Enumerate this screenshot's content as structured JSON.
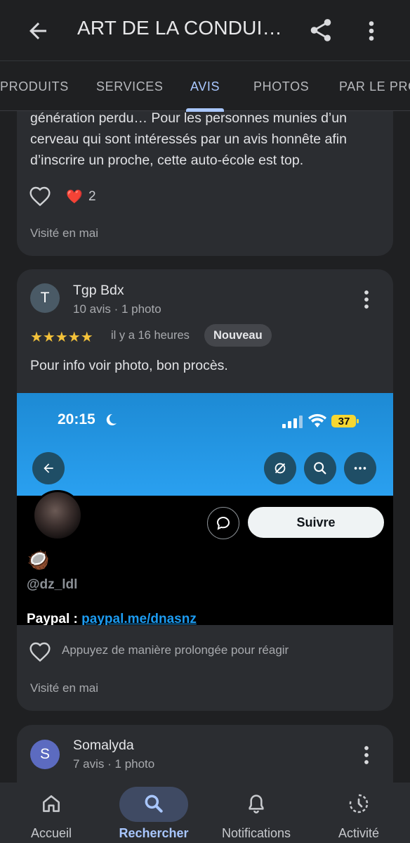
{
  "appbar": {
    "title": "ART DE LA CONDUI…"
  },
  "tabs": [
    {
      "label": "PRODUITS"
    },
    {
      "label": "SERVICES"
    },
    {
      "label": "AVIS",
      "active": true
    },
    {
      "label": "PHOTOS"
    },
    {
      "label": "PAR LE PRO"
    }
  ],
  "review1": {
    "text_lines": [
      "génération perdu… Pour les personnes munies d’un",
      "cerveau qui sont intéressés par un avis honnête afin",
      "d’inscrire un proche, cette auto-école est top."
    ],
    "reaction_emoji": "❤️",
    "reaction_count": "2",
    "visited": "Visité en mai"
  },
  "review2": {
    "avatar_letter": "T",
    "avatar_color": "#4a5a66",
    "name": "Tgp Bdx",
    "meta": "10 avis · 1 photo",
    "stars": "★★★★★",
    "rating": 5,
    "ago": "il y a 16 heures",
    "badge": "Nouveau",
    "text": "Pour info voir photo, bon procès.",
    "photo": {
      "time": "20:15",
      "battery": "37",
      "follow_label": "Suivre",
      "coconut": "🥥",
      "handle": "@dz_ldl",
      "paypal_label": "Paypal : ",
      "paypal_link": "paypal.me/dnasnz"
    },
    "react_hint": "Appuyez de manière prolongée pour réagir",
    "visited": "Visité en mai"
  },
  "review3": {
    "avatar_letter": "S",
    "avatar_color": "#5c6bc0",
    "name": "Somalyda",
    "meta": "7 avis · 1 photo"
  },
  "bottomnav": [
    {
      "label": "Accueil",
      "icon": "home-icon"
    },
    {
      "label": "Rechercher",
      "icon": "search-icon",
      "active": true
    },
    {
      "label": "Notifications",
      "icon": "bell-icon"
    },
    {
      "label": "Activité",
      "icon": "history-icon"
    }
  ],
  "colors": {
    "accent": "#a9c7ff",
    "card": "#2b2d31",
    "background": "#1f2022",
    "star": "#f4c23a"
  }
}
